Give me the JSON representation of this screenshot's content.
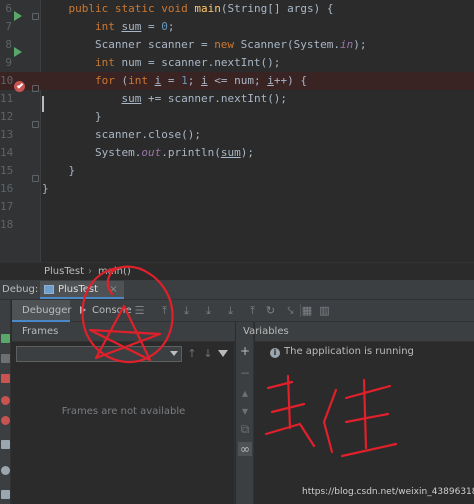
{
  "editor": {
    "lines": [
      {
        "number": "6",
        "segments": [
          {
            "t": "    "
          },
          {
            "t": "public",
            "c": "kw"
          },
          {
            "t": " "
          },
          {
            "t": "static",
            "c": "kw"
          },
          {
            "t": " "
          },
          {
            "t": "void",
            "c": "kw"
          },
          {
            "t": " "
          },
          {
            "t": "main",
            "c": "fn"
          },
          {
            "t": "(String[] args) {"
          }
        ]
      },
      {
        "number": "7",
        "segments": [
          {
            "t": "        "
          },
          {
            "t": "int",
            "c": "kw"
          },
          {
            "t": " "
          },
          {
            "t": "sum",
            "c": "ul"
          },
          {
            "t": " = "
          },
          {
            "t": "0",
            "c": "num"
          },
          {
            "t": ";"
          }
        ]
      },
      {
        "number": "8",
        "segments": [
          {
            "t": "        Scanner scanner = "
          },
          {
            "t": "new",
            "c": "kw"
          },
          {
            "t": " Scanner(System."
          },
          {
            "t": "in",
            "c": "ital"
          },
          {
            "t": ");"
          }
        ]
      },
      {
        "number": "9",
        "segments": [
          {
            "t": "        "
          },
          {
            "t": "int",
            "c": "kw"
          },
          {
            "t": " num = scanner.nextInt();"
          }
        ]
      },
      {
        "number": "10",
        "segments": [
          {
            "t": "        "
          },
          {
            "t": "for",
            "c": "kw"
          },
          {
            "t": " ("
          },
          {
            "t": "int",
            "c": "kw"
          },
          {
            "t": " "
          },
          {
            "t": "i",
            "c": "ul"
          },
          {
            "t": " = "
          },
          {
            "t": "1",
            "c": "num"
          },
          {
            "t": "; "
          },
          {
            "t": "i",
            "c": "ul"
          },
          {
            "t": " <= num; "
          },
          {
            "t": "i",
            "c": "ul"
          },
          {
            "t": "++) {"
          }
        ]
      },
      {
        "number": "11",
        "segments": [
          {
            "t": "            "
          },
          {
            "t": "sum",
            "c": "ul"
          },
          {
            "t": " += scanner.nextInt();"
          }
        ]
      },
      {
        "number": "12",
        "segments": [
          {
            "t": "        }"
          }
        ]
      },
      {
        "number": "13",
        "segments": [
          {
            "t": "        scanner.close();"
          }
        ]
      },
      {
        "number": "14",
        "segments": [
          {
            "t": "        System."
          },
          {
            "t": "out",
            "c": "ital"
          },
          {
            "t": ".println("
          },
          {
            "t": "sum",
            "c": "ul"
          },
          {
            "t": ");"
          }
        ]
      },
      {
        "number": "15",
        "segments": [
          {
            "t": "    }"
          }
        ]
      },
      {
        "number": "16",
        "segments": [
          {
            "t": "}"
          }
        ]
      },
      {
        "number": "17",
        "segments": []
      },
      {
        "number": "18",
        "segments": []
      }
    ]
  },
  "breadcrumb": {
    "class_name": "PlusTest",
    "method_name": "main()"
  },
  "debug": {
    "label": "Debug:",
    "session_tab": "PlusTest",
    "session_close": "×",
    "tabs": {
      "debugger": "Debugger",
      "console": "Console"
    },
    "frames": {
      "header": "Frames",
      "empty_text": "Frames are not available"
    },
    "variables": {
      "header": "Variables",
      "info_icon_glyph": "i",
      "status_text": "The application is running"
    }
  },
  "watermark": "https://blog.csdn.net/weixin_43896318",
  "colors": {
    "keyword": "#cc7832",
    "method": "#ffc66d",
    "number": "#6897bb",
    "field": "#9876aa",
    "breakpoint": "#c75450",
    "scribble": "#e0202a",
    "run_arrow": "#59a869"
  }
}
